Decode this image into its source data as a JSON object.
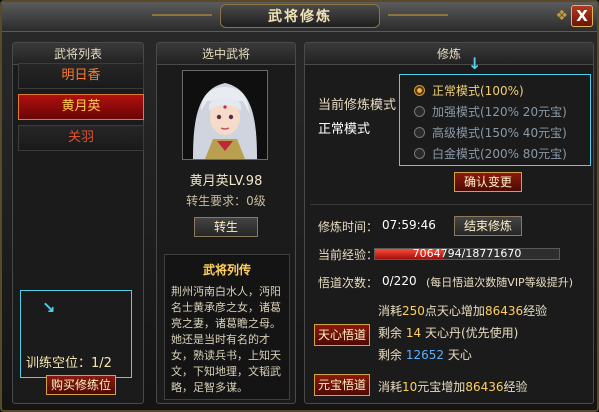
{
  "window": {
    "title": "武将修炼",
    "close_label": "X"
  },
  "left_panel": {
    "header": "武将列表",
    "generals": [
      {
        "name": "明日香",
        "selected": false
      },
      {
        "name": "黄月英",
        "selected": true
      },
      {
        "name": "关羽",
        "selected": false
      }
    ],
    "slots_label": "训练空位：",
    "slots_value": "1/2",
    "buy_slot_button": "购买修练位"
  },
  "middle_panel": {
    "header": "选中武将",
    "general_name_level": "黄月英LV.98",
    "rebirth_req": "转生要求：0级",
    "rebirth_button": "转生",
    "bio_title": "武将列传",
    "bio_text": "荆州沔南白水人，沔阳名士黄承彦之女，诸葛亮之妻，诸葛瞻之母。她还是当时有名的才女，熟读兵书，上知天文，下知地理，文韬武略，足智多谋。"
  },
  "right_panel": {
    "header": "修炼",
    "current_mode_label": "当前修炼模式",
    "current_mode_value": "正常模式",
    "modes": [
      {
        "label": "正常模式(100%)",
        "selected": true
      },
      {
        "label": "加强模式(120% 20元宝)",
        "selected": false
      },
      {
        "label": "高级模式(150% 40元宝)",
        "selected": false
      },
      {
        "label": "白金模式(200% 80元宝)",
        "selected": false
      }
    ],
    "confirm_button": "确认变更",
    "time_label": "修炼时间：",
    "time_value": "07:59:46",
    "end_button": "结束修炼",
    "exp_label": "当前经验：",
    "exp_value": "7064794/18771670",
    "exp_current": 7064794,
    "exp_max": 18771670,
    "accel_label": "悟道次数：",
    "accel_value": "0/220",
    "accel_note": "(每日悟道次数随VIP等级提升)",
    "tianxin_button": "天心悟道",
    "tianxin_cost_1": "消耗",
    "tianxin_cost_num": "250",
    "tianxin_cost_2": "点天心增加",
    "tianxin_gain": "86436",
    "tianxin_cost_3": "经验",
    "remain_label": "剩余",
    "pill_count": "14",
    "pill_text": "天心丹(优先使用)",
    "tianxin_remain": "12652",
    "tianxin_unit": "天心",
    "yuanbao_button": "元宝悟道",
    "yuanbao_cost_1": "消耗",
    "yuanbao_cost_num": "10",
    "yuanbao_cost_2": "元宝增加",
    "yuanbao_gain": "86436",
    "yuanbao_cost_3": "经验"
  }
}
